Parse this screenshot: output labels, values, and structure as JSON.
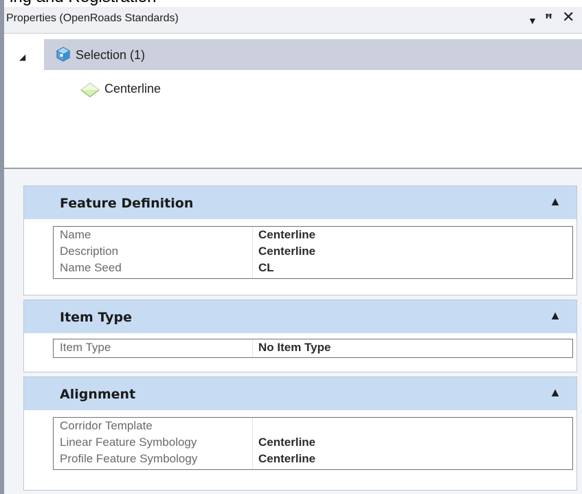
{
  "top_clipped_text": "ing and Registration",
  "panel": {
    "title": "Properties (OpenRoads Standards)",
    "buttons": {
      "dropdown": "▼",
      "pin": "ꟸ",
      "close": "✕"
    }
  },
  "tree": {
    "selection": {
      "label": "Selection (1)",
      "expander": "◢"
    },
    "child": {
      "label": "Centerline"
    }
  },
  "sections": {
    "feature_definition": {
      "title": "Feature Definition",
      "rows": [
        {
          "name": "Name",
          "value": "Centerline"
        },
        {
          "name": "Description",
          "value": "Centerline"
        },
        {
          "name": "Name Seed",
          "value": "CL"
        }
      ]
    },
    "item_type": {
      "title": "Item Type",
      "rows": [
        {
          "name": "Item Type",
          "value": "No Item Type"
        }
      ]
    },
    "alignment": {
      "title": "Alignment",
      "rows": [
        {
          "name": "Corridor Template",
          "value": ""
        },
        {
          "name": "Linear Feature Symbology",
          "value": "Centerline"
        },
        {
          "name": "Profile Feature Symbology",
          "value": "Centerline"
        }
      ]
    }
  },
  "colors": {
    "section_header": "#c7dcf2",
    "selected_row": "#cbd0dc",
    "titlebar": "#eef0f4"
  },
  "icons": {
    "selection": "selection-cube-icon",
    "centerline": "linear-feature-diamond-icon",
    "collapse": "chevron-up-icon"
  }
}
